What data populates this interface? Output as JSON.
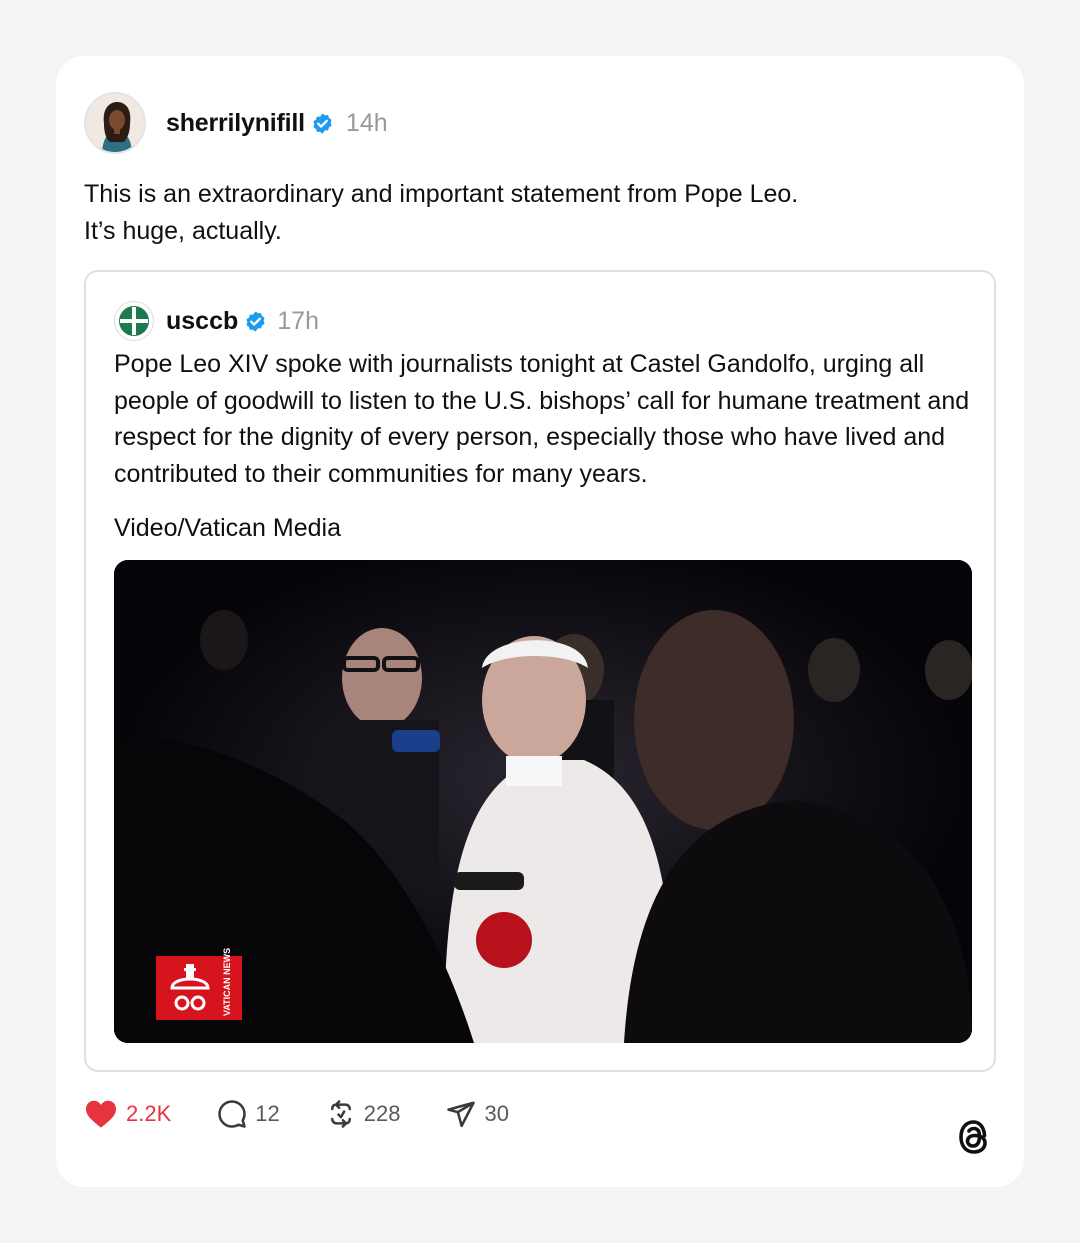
{
  "post": {
    "author": {
      "username": "sherrilynifill",
      "verified": true,
      "time": "14h"
    },
    "text_lines": [
      "This is an extraordinary and important statement from Pope Leo.",
      "It’s huge, actually."
    ],
    "quoted": {
      "author": {
        "username": "usccb",
        "verified": true,
        "time": "17h"
      },
      "text": "Pope Leo XIV spoke with journalists tonight at Castel Gandolfo, urging all people of goodwill to listen to the U.S. bishops’ call for humane treatment and respect for the dignity of every person, especially those who have lived and contributed to their communities for many years.",
      "credit": "Video/Vatican Media",
      "video": {
        "watermark": "VATICAN NEWS"
      }
    },
    "actions": {
      "likes": "2.2K",
      "replies": "12",
      "reposts": "228",
      "shares": "30"
    }
  },
  "colors": {
    "like": "#e5333f",
    "verified": "#1d9bf0",
    "muted": "#999999",
    "vatican_red": "#d7141d",
    "usccb_green": "#1b7a4e"
  },
  "icons": [
    "heart-icon",
    "comment-icon",
    "repost-icon",
    "send-icon",
    "verified-badge-icon",
    "threads-logo-icon"
  ]
}
